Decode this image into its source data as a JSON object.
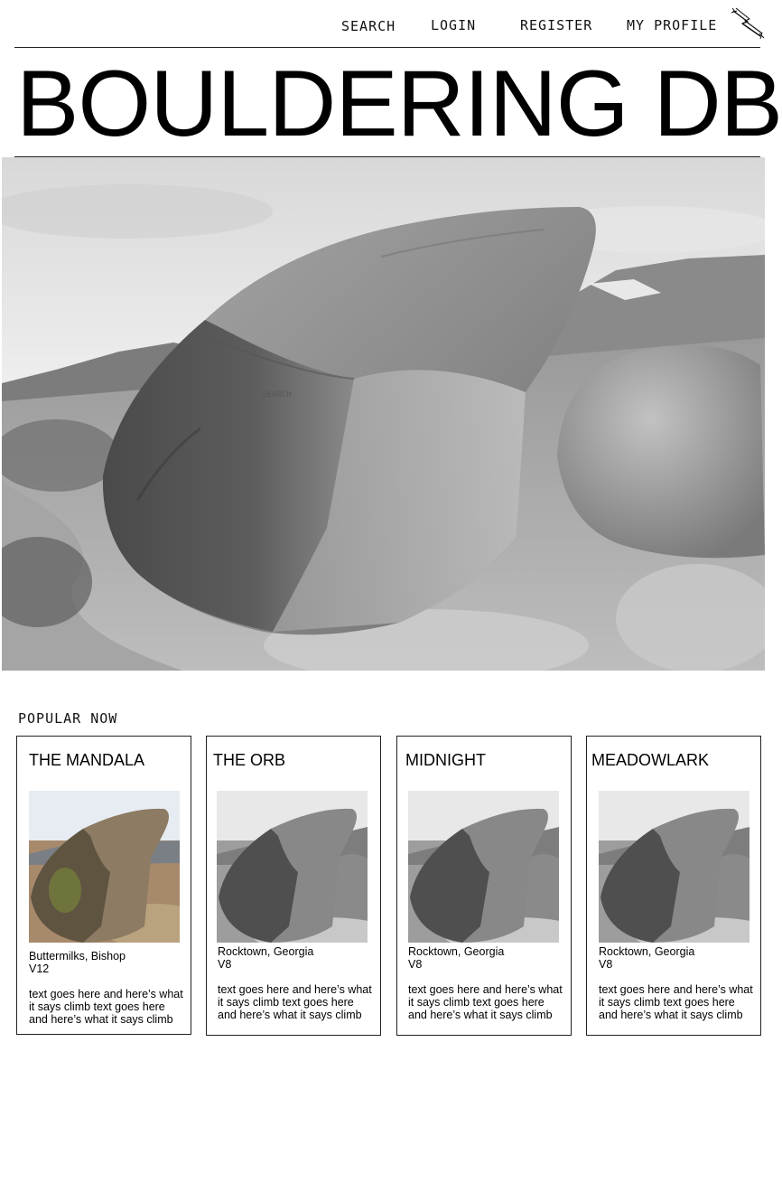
{
  "nav": {
    "search": "SEARCH",
    "login": "LOGIN",
    "register": "REGISTER",
    "profile": "MY PROFILE"
  },
  "site_title": "BOULDERING DB",
  "hero": {
    "caption": "SEARCH"
  },
  "popular": {
    "heading": "POPULAR NOW",
    "cards": [
      {
        "name": "THE MANDALA",
        "location": "Buttermilks, Bishop",
        "grade": "V12",
        "description": "text goes here and here’s what it says climb text goes here and here’s what it says climb",
        "photo": "color"
      },
      {
        "name": "THE ORB",
        "location": "Rocktown, Georgia",
        "grade": "V8",
        "description": "text goes here and here’s what it says climb text goes here and here’s what it says climb",
        "photo": "grayscale"
      },
      {
        "name": "MIDNIGHT",
        "location": "Rocktown, Georgia",
        "grade": "V8",
        "description": "text goes here and here’s what it says climb text goes here and here’s what it says climb",
        "photo": "grayscale"
      },
      {
        "name": "MEADOWLARK",
        "location": "Rocktown, Georgia",
        "grade": "V8",
        "description": "text goes here and here’s what it says climb text goes here and here’s what it says climb",
        "photo": "grayscale"
      }
    ]
  },
  "colors": {
    "text": "#000000",
    "rule": "#222222",
    "background": "#ffffff"
  }
}
